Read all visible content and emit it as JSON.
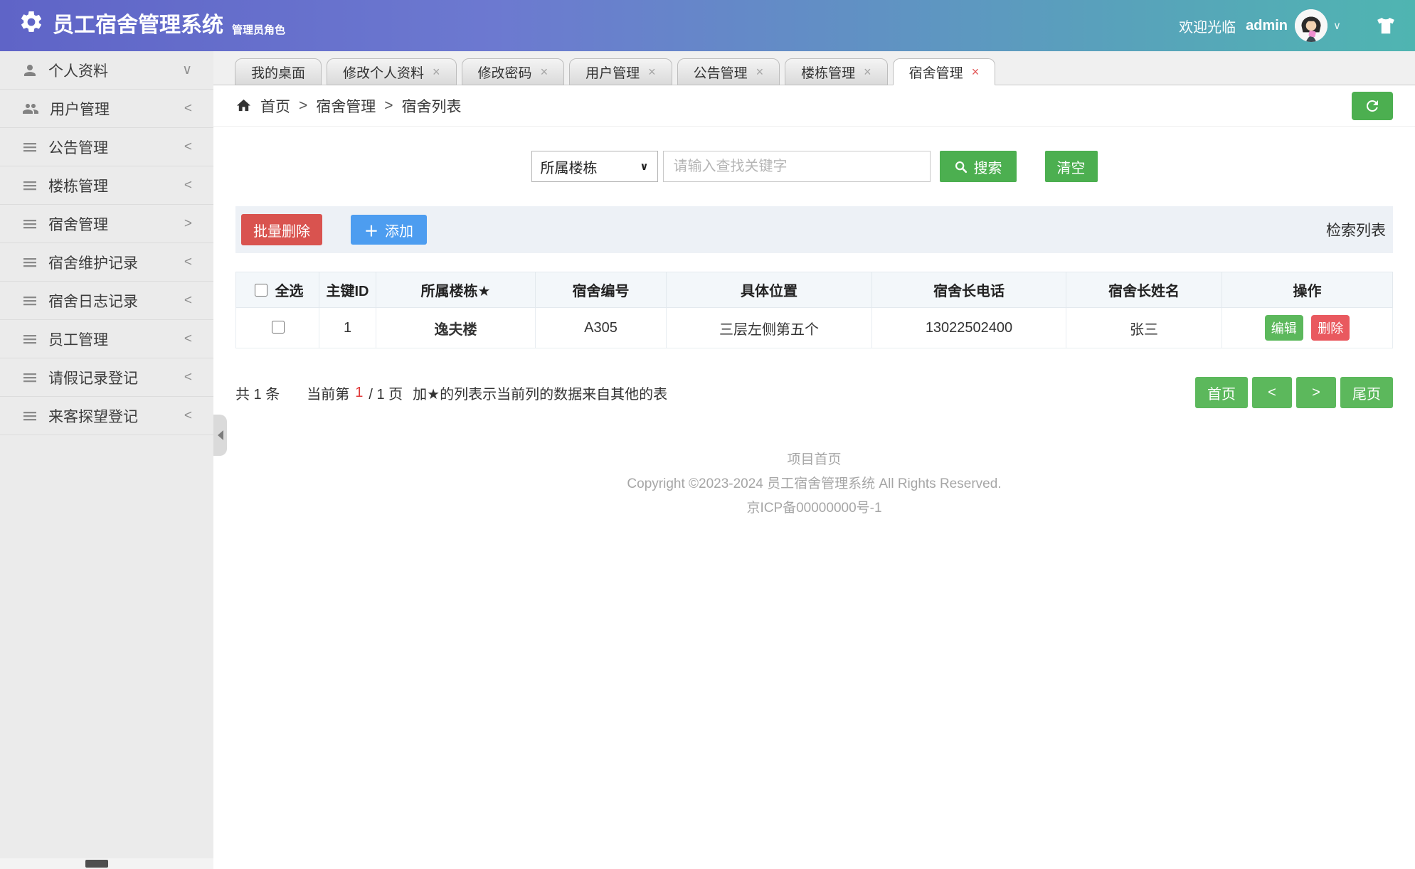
{
  "header": {
    "title": "员工宿舍管理系统",
    "subtitle": "管理员角色",
    "welcome": "欢迎光临",
    "username": "admin"
  },
  "icons": {
    "close": "×",
    "plus": "＋",
    "select_caret": "∨",
    "user_caret": "∨"
  },
  "sidebar": {
    "items": [
      {
        "label": "个人资料",
        "icon": "person-icon",
        "chevron": "∨"
      },
      {
        "label": "用户管理",
        "icon": "people-icon",
        "chevron": "<"
      },
      {
        "label": "公告管理",
        "icon": "list-icon",
        "chevron": "<"
      },
      {
        "label": "楼栋管理",
        "icon": "list-icon",
        "chevron": "<"
      },
      {
        "label": "宿舍管理",
        "icon": "list-icon",
        "chevron": ">"
      },
      {
        "label": "宿舍维护记录",
        "icon": "list-icon",
        "chevron": "<"
      },
      {
        "label": "宿舍日志记录",
        "icon": "list-icon",
        "chevron": "<"
      },
      {
        "label": "员工管理",
        "icon": "list-icon",
        "chevron": "<"
      },
      {
        "label": "请假记录登记",
        "icon": "list-icon",
        "chevron": "<"
      },
      {
        "label": "来客探望登记",
        "icon": "list-icon",
        "chevron": "<"
      }
    ]
  },
  "tabs": [
    {
      "label": "我的桌面",
      "closable": false,
      "active": false
    },
    {
      "label": "修改个人资料",
      "closable": true,
      "active": false
    },
    {
      "label": "修改密码",
      "closable": true,
      "active": false
    },
    {
      "label": "用户管理",
      "closable": true,
      "active": false
    },
    {
      "label": "公告管理",
      "closable": true,
      "active": false
    },
    {
      "label": "楼栋管理",
      "closable": true,
      "active": false
    },
    {
      "label": "宿舍管理",
      "closable": true,
      "active": true
    }
  ],
  "breadcrumb": {
    "home": "首页",
    "separator": ">",
    "items": [
      "宿舍管理",
      "宿舍列表"
    ]
  },
  "search": {
    "select_value": "所属楼栋",
    "input_placeholder": "请输入查找关键字",
    "search_label": "搜索",
    "clear_label": "清空"
  },
  "actions": {
    "batch_delete_label": "批量删除",
    "add_label": "添加",
    "list_label": "检索列表"
  },
  "table": {
    "headers": [
      "全选",
      "主键ID",
      "所属楼栋★",
      "宿舍编号",
      "具体位置",
      "宿舍长电话",
      "宿舍长姓名",
      "操作"
    ],
    "rows": [
      {
        "id": "1",
        "building": "逸夫楼",
        "room": "A305",
        "location": "三层左侧第五个",
        "phone": "13022502400",
        "leader": "张三",
        "edit_label": "编辑",
        "delete_label": "删除"
      }
    ]
  },
  "pagination": {
    "total": "共 1 条",
    "current_label": "当前第",
    "page_num": "1",
    "page_suffix": "/ 1 页",
    "note": "加★的列表示当前列的数据来自其他的表",
    "first_label": "首页",
    "prev_label": "<",
    "next_label": ">",
    "last_label": "尾页"
  },
  "footer": {
    "home_link": "项目首页",
    "copyright": "Copyright ©2023-2024 员工宿舍管理系统 All Rights Reserved.",
    "icp": "京ICP备00000000号-1"
  },
  "colors": {
    "header_gradient_left": "#5f64c7",
    "header_gradient_right": "#4fb5b1",
    "green_button": "#4caf50",
    "pagination_green": "#5cb85c",
    "batch_delete_red": "#d9534f",
    "delete_badge_red": "#e9595f",
    "add_blue": "#4d9df0",
    "building_text_red": "#c9343d",
    "page_num_red": "#e03a3a",
    "sidebar_bg": "#ebebeb",
    "actions_band_bg": "#edf1f6",
    "table_header_bg": "#f3f7fa"
  }
}
